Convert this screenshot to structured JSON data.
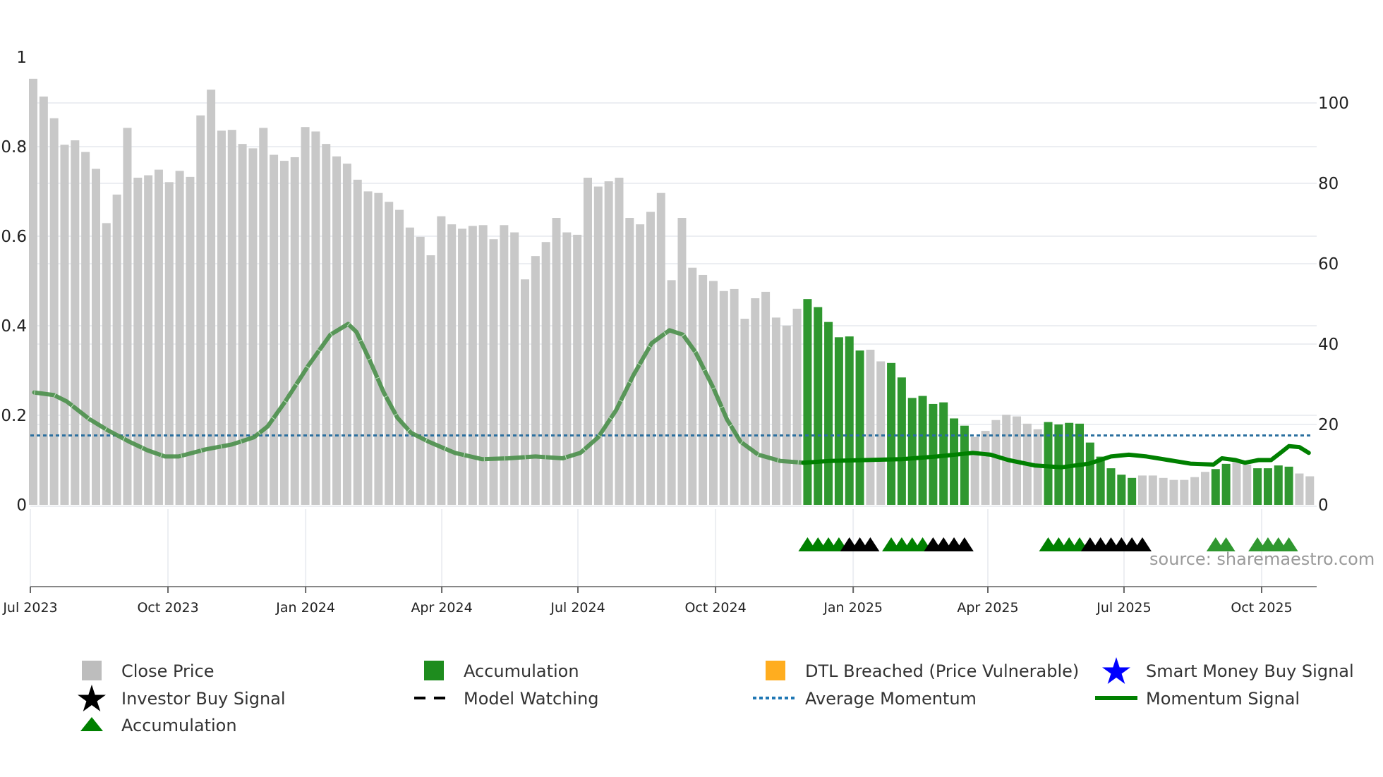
{
  "chart_data": {
    "type": "bar",
    "title": "",
    "source": "source: sharemaestro.com",
    "left_axis": {
      "ticks": [
        "0",
        "0.2",
        "0.4",
        "0.6",
        "0.8",
        "1"
      ],
      "values": [
        0,
        0.2,
        0.4,
        0.6,
        0.8,
        1
      ],
      "range": [
        0,
        1
      ]
    },
    "right_axis": {
      "ticks": [
        "0",
        "20",
        "40",
        "60",
        "80",
        "100"
      ],
      "values": [
        0,
        20,
        40,
        60,
        80,
        100
      ],
      "range": [
        0,
        111.4
      ]
    },
    "x_ticks": [
      {
        "label": "Jul 2023",
        "date": "2023-07-01"
      },
      {
        "label": "Oct 2023",
        "date": "2023-10-01"
      },
      {
        "label": "Jan 2024",
        "date": "2024-01-01"
      },
      {
        "label": "Apr 2024",
        "date": "2024-04-01"
      },
      {
        "label": "Jul 2024",
        "date": "2024-07-01"
      },
      {
        "label": "Oct 2024",
        "date": "2024-10-01"
      },
      {
        "label": "Jan 2025",
        "date": "2025-01-01"
      },
      {
        "label": "Apr 2025",
        "date": "2025-04-01"
      },
      {
        "label": "Jul 2025",
        "date": "2025-07-01"
      },
      {
        "label": "Oct 2025",
        "date": "2025-10-01"
      }
    ],
    "bar_interval": "weekly",
    "close_price": [
      106.0,
      101.6,
      96.2,
      89.6,
      90.7,
      87.8,
      83.6,
      70.1,
      77.2,
      93.8,
      81.4,
      82.0,
      83.4,
      80.3,
      83.1,
      81.6,
      96.9,
      103.3,
      93.1,
      93.3,
      89.8,
      88.7,
      93.8,
      87.1,
      85.6,
      86.5,
      94.0,
      92.9,
      89.8,
      86.7,
      84.9,
      80.9,
      78.0,
      77.6,
      75.4,
      73.4,
      69.0,
      66.7,
      62.1,
      71.8,
      69.8,
      68.7,
      69.4,
      69.6,
      66.1,
      69.6,
      67.8,
      56.1,
      61.9,
      65.4,
      71.4,
      67.8,
      67.2,
      81.4,
      79.2,
      80.5,
      81.4,
      71.4,
      69.8,
      72.9,
      77.6,
      55.9,
      71.4,
      59.0,
      57.2,
      55.7,
      53.2,
      53.7,
      46.3,
      51.4,
      53.0,
      46.6,
      44.6,
      48.8,
      51.2,
      49.2,
      45.5,
      41.7,
      41.9,
      38.4,
      38.6,
      35.7,
      35.3,
      31.7,
      26.6,
      27.1,
      25.1,
      25.5,
      21.5,
      19.7,
      16.9,
      18.4,
      21.1,
      22.4,
      22.0,
      20.2,
      18.8,
      20.6,
      20.0,
      20.4,
      20.2,
      15.5,
      12.0,
      9.1,
      7.5,
      6.7,
      7.3,
      7.3,
      6.7,
      6.2,
      6.2,
      6.9,
      8.2,
      8.9,
      10.2,
      10.6,
      10.0,
      9.1,
      9.1,
      9.8,
      9.5,
      7.8,
      7.1
    ],
    "accumulation_bar_ranges": [
      [
        74,
        79
      ],
      [
        82,
        89
      ],
      [
        97,
        105
      ],
      [
        113,
        114
      ],
      [
        117,
        120
      ]
    ],
    "average_momentum": 0.155,
    "momentum_signal": {
      "solid_from_week": 74,
      "points": [
        [
          0.1,
          0.251
        ],
        [
          2,
          0.245
        ],
        [
          3.2,
          0.231
        ],
        [
          5.4,
          0.191
        ],
        [
          7.1,
          0.167
        ],
        [
          9.2,
          0.141
        ],
        [
          10.9,
          0.122
        ],
        [
          12.6,
          0.108
        ],
        [
          13.9,
          0.108
        ],
        [
          16.5,
          0.124
        ],
        [
          19,
          0.135
        ],
        [
          21.1,
          0.151
        ],
        [
          22.4,
          0.175
        ],
        [
          24.1,
          0.231
        ],
        [
          26.3,
          0.311
        ],
        [
          28.4,
          0.38
        ],
        [
          30.1,
          0.404
        ],
        [
          30.9,
          0.386
        ],
        [
          32.2,
          0.321
        ],
        [
          33.5,
          0.251
        ],
        [
          34.8,
          0.195
        ],
        [
          36.1,
          0.161
        ],
        [
          37.8,
          0.141
        ],
        [
          40.3,
          0.116
        ],
        [
          42.9,
          0.102
        ],
        [
          45.4,
          0.104
        ],
        [
          48,
          0.108
        ],
        [
          50.6,
          0.104
        ],
        [
          52.3,
          0.116
        ],
        [
          54,
          0.151
        ],
        [
          55.7,
          0.211
        ],
        [
          57.4,
          0.291
        ],
        [
          59.1,
          0.361
        ],
        [
          60.8,
          0.39
        ],
        [
          62.1,
          0.38
        ],
        [
          63.3,
          0.341
        ],
        [
          65,
          0.261
        ],
        [
          66.3,
          0.191
        ],
        [
          67.6,
          0.141
        ],
        [
          69.3,
          0.112
        ],
        [
          71.4,
          0.098
        ],
        [
          73.6,
          0.094
        ],
        [
          76.1,
          0.098
        ],
        [
          79.5,
          0.1
        ],
        [
          83,
          0.102
        ],
        [
          86.4,
          0.108
        ],
        [
          89.8,
          0.116
        ],
        [
          91.5,
          0.112
        ],
        [
          93.2,
          0.1
        ],
        [
          95.7,
          0.088
        ],
        [
          98.3,
          0.084
        ],
        [
          100.9,
          0.092
        ],
        [
          103,
          0.108
        ],
        [
          104.7,
          0.112
        ],
        [
          106.4,
          0.108
        ],
        [
          108.5,
          0.1
        ],
        [
          110.6,
          0.092
        ],
        [
          112.8,
          0.09
        ],
        [
          113.6,
          0.104
        ],
        [
          114.9,
          0.1
        ],
        [
          115.8,
          0.094
        ],
        [
          117.1,
          0.1
        ],
        [
          118.3,
          0.1
        ],
        [
          119.2,
          0.116
        ],
        [
          120,
          0.131
        ],
        [
          121,
          0.129
        ],
        [
          121.9,
          0.116
        ]
      ]
    },
    "markers": {
      "accumulation_weeks": [
        74,
        75,
        76,
        77,
        82,
        83,
        84,
        85,
        97,
        98,
        99,
        100
      ],
      "investor_buy_weeks": [
        78,
        79,
        80,
        86,
        87,
        88,
        89,
        101,
        102,
        103,
        104,
        105,
        106
      ],
      "accumulation_light_weeks": [
        113,
        114,
        117,
        118,
        119,
        120
      ]
    },
    "legend": [
      {
        "label": "Close Price",
        "icon": "square",
        "color": "#bdbdbd"
      },
      {
        "label": "Accumulation",
        "icon": "square",
        "color": "#1e8c1e"
      },
      {
        "label": "DTL Breached (Price Vulnerable)",
        "icon": "square",
        "color": "#ffad1f"
      },
      {
        "label": "Smart Money Buy Signal",
        "icon": "star",
        "color": "#0000ff"
      },
      {
        "label": "Investor Buy Signal",
        "icon": "star",
        "color": "#000000"
      },
      {
        "label": "Model Watching",
        "icon": "dashed-line",
        "color": "#000000"
      },
      {
        "label": "Average Momentum",
        "icon": "dotted-line",
        "color": "#1f77b4"
      },
      {
        "label": "Momentum Signal",
        "icon": "solid-line",
        "color": "#008000"
      },
      {
        "label": "Accumulation",
        "icon": "triangle",
        "color": "#008000"
      }
    ],
    "legend_placement": "bottom",
    "colors": {
      "close": "#c8c8c8",
      "accum_bar": "#2f972f",
      "momentum_faded": "#4a8f4a",
      "momentum": "#008000",
      "avg": "#2a6f9f",
      "grid": "#eceef2"
    }
  }
}
